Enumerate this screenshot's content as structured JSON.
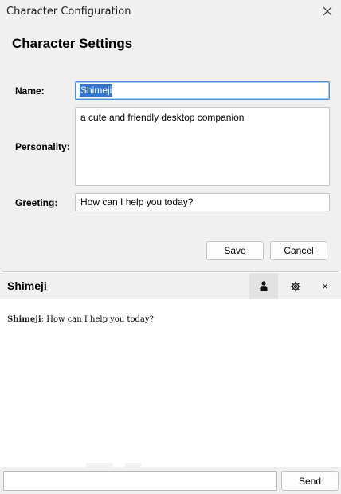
{
  "dialog": {
    "title": "Character Configuration",
    "heading": "Character Settings",
    "fields": {
      "name": {
        "label": "Name:",
        "value": "Shimeji"
      },
      "personality": {
        "label": "Personality:",
        "value": "a cute and friendly desktop companion"
      },
      "greeting": {
        "label": "Greeting:",
        "value": "How can I help you today?"
      }
    },
    "buttons": {
      "save": "Save",
      "cancel": "Cancel"
    }
  },
  "chat": {
    "title": "Shimeji",
    "header_icons": [
      "person-icon",
      "gear-icon",
      "close-icon"
    ],
    "close_glyph": "×",
    "messages": [
      {
        "sender": "Shimeji",
        "separator": ":",
        "text": "How can I help you today?"
      }
    ],
    "input": {
      "value": "",
      "placeholder": ""
    },
    "send_label": "Send"
  },
  "colors": {
    "window_bg": "#f0f0f0",
    "selection": "#3476d2",
    "focus_border": "#4a90d9"
  }
}
